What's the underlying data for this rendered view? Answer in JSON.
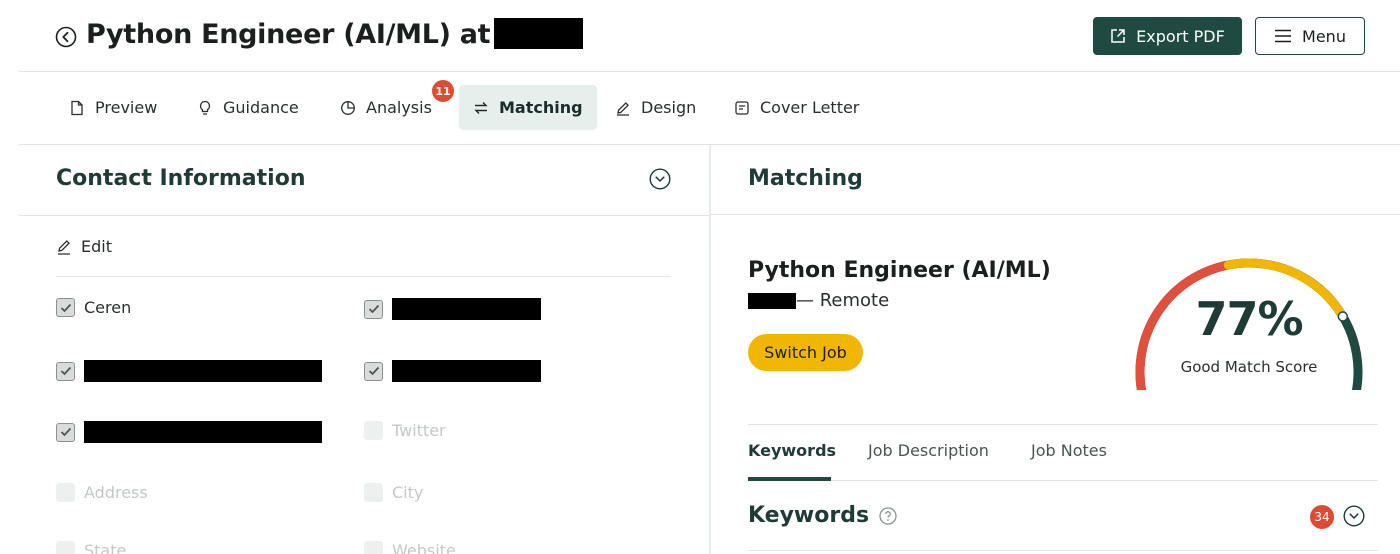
{
  "header": {
    "title": "Python Engineer (AI/ML) at",
    "export_label": "Export PDF",
    "menu_label": "Menu"
  },
  "tabs": [
    {
      "label": "Preview",
      "icon": "file-icon"
    },
    {
      "label": "Guidance",
      "icon": "lightbulb-icon"
    },
    {
      "label": "Analysis",
      "icon": "pie-chart-icon",
      "badge": "11"
    },
    {
      "label": "Matching",
      "icon": "swap-arrows-icon",
      "active": true
    },
    {
      "label": "Design",
      "icon": "pencil-icon"
    },
    {
      "label": "Cover Letter",
      "icon": "cover-letter-icon"
    }
  ],
  "contact": {
    "title": "Contact Information",
    "edit_label": "Edit",
    "fields": [
      {
        "label": "Ceren",
        "checked": true
      },
      {
        "label": "",
        "checked": true,
        "redacted": true
      },
      {
        "label": "",
        "checked": true,
        "redacted": true
      },
      {
        "label": "",
        "checked": true,
        "redacted": true
      },
      {
        "label": "",
        "checked": true,
        "redacted": true
      },
      {
        "label": "Twitter",
        "checked": false
      },
      {
        "label": "Address",
        "checked": false
      },
      {
        "label": "City",
        "checked": false
      },
      {
        "label": "State",
        "checked": false
      },
      {
        "label": "Website",
        "checked": false
      }
    ]
  },
  "matching": {
    "title": "Matching",
    "job_title": "Python Engineer (AI/ML)",
    "job_location": "— Remote",
    "switch_label": "Switch Job",
    "score_text": "77%",
    "score": 77,
    "score_label": "Good Match Score",
    "gauge_colors": {
      "low": "#e0503c",
      "mid": "#f1b600",
      "high": "#1e4a42"
    },
    "subtabs": [
      "Keywords",
      "Job Description",
      "Job Notes"
    ],
    "keywords_title": "Keywords",
    "keywords_count": "34"
  },
  "colors": {
    "accent": "#1e4a42",
    "badge": "#de4b35",
    "highlight": "#f1b600"
  }
}
